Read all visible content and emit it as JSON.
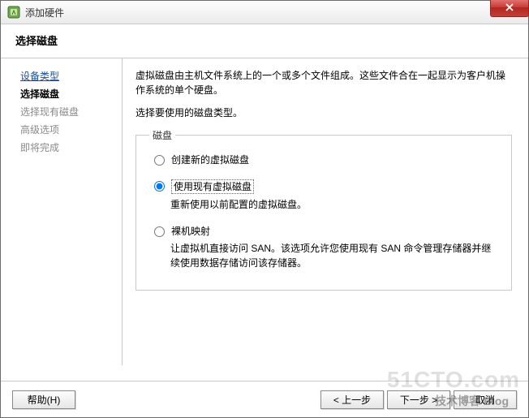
{
  "window": {
    "title": "添加硬件"
  },
  "header": {
    "heading": "选择磁盘"
  },
  "sidebar": {
    "steps": [
      {
        "label": "设备类型",
        "state": "link"
      },
      {
        "label": "选择磁盘",
        "state": "current"
      },
      {
        "label": "选择现有磁盘",
        "state": "pending"
      },
      {
        "label": "高级选项",
        "state": "pending"
      },
      {
        "label": "即将完成",
        "state": "pending"
      }
    ]
  },
  "content": {
    "desc1": "虚拟磁盘由主机文件系统上的一个或多个文件组成。这些文件合在一起显示为客户机操作系统的单个硬盘。",
    "desc2": "选择要使用的磁盘类型。",
    "group_legend": "磁盘",
    "options": [
      {
        "label": "创建新的虚拟磁盘",
        "desc": "",
        "selected": false
      },
      {
        "label": "使用现有虚拟磁盘",
        "desc": "重新使用以前配置的虚拟磁盘。",
        "selected": true
      },
      {
        "label": "裸机映射",
        "desc": "让虚拟机直接访问 SAN。该选项允许您使用现有 SAN 命令管理存储器并继续使用数据存储访问该存储器。",
        "selected": false
      }
    ]
  },
  "footer": {
    "help": "帮助(H)",
    "back": "< 上一步",
    "next": "下一步 >",
    "cancel": "取消"
  },
  "watermark": {
    "big": "51CTO.com",
    "small": "技术博客 Blog"
  }
}
